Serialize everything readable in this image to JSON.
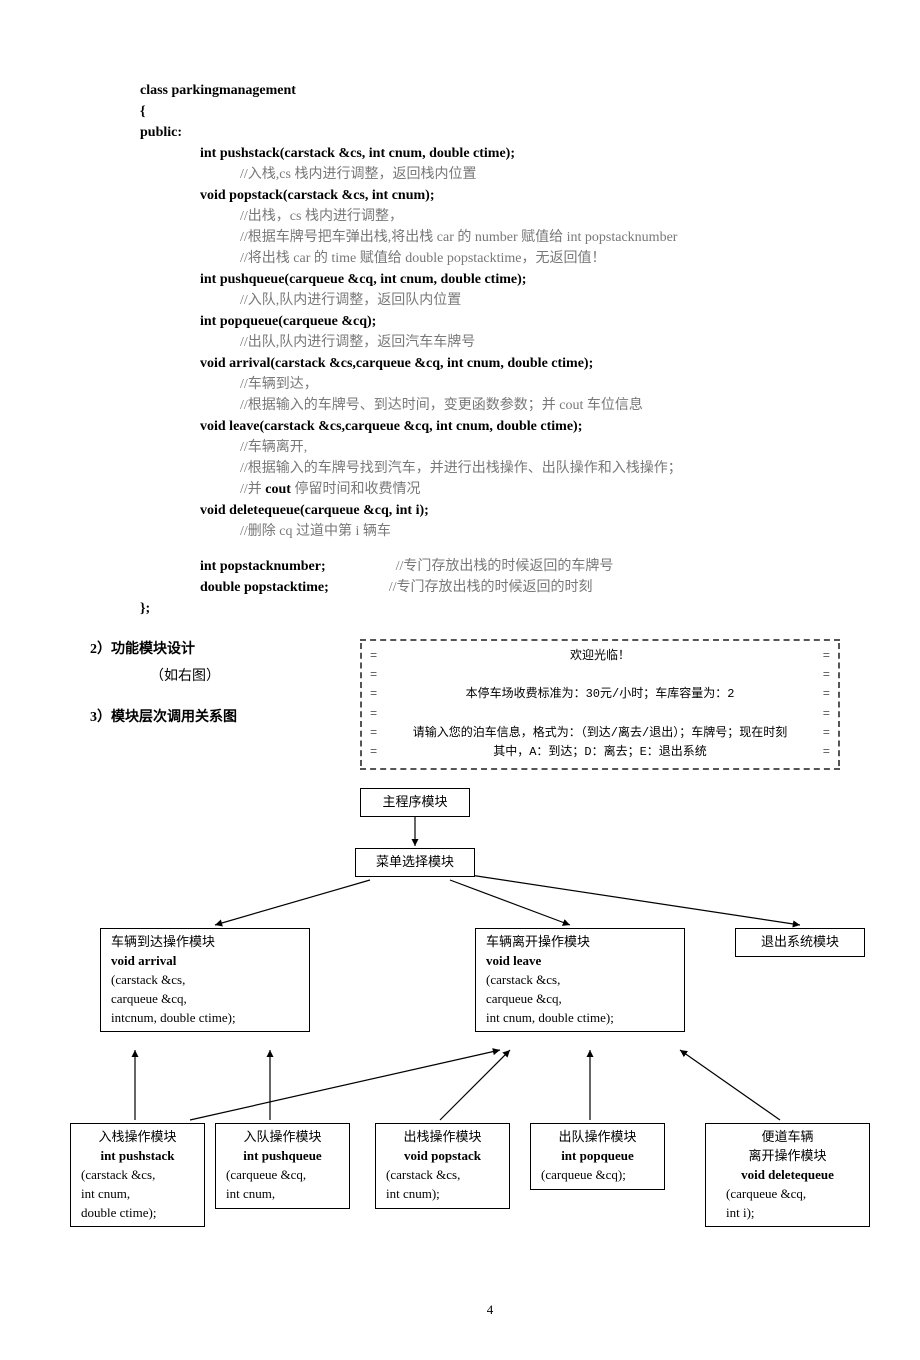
{
  "code": {
    "l1": "class parkingmanagement",
    "l2": "{",
    "l3": "public:",
    "l4": "int pushstack(carstack &cs, int cnum, double ctime);",
    "l5": "//入栈,cs 栈内进行调整，返回栈内位置",
    "l6": "void popstack(carstack &cs, int cnum);",
    "l7a": "//出栈，cs 栈内进行调整，",
    "l7b": "//根据车牌号把车弹出栈,将出栈 car 的 number 赋值给 int popstacknumber",
    "l7c": "//将出栈 car 的 time 赋值给 double popstacktime，无返回值！",
    "l8": "int pushqueue(carqueue &cq, int cnum, double ctime);",
    "l9": "//入队,队内进行调整，返回队内位置",
    "l10": "int popqueue(carqueue &cq);",
    "l11": "//出队,队内进行调整，返回汽车车牌号",
    "l12": "void arrival(carstack &cs,carqueue &cq, int cnum, double ctime);",
    "l13a": "//车辆到达，",
    "l13b": "//根据输入的车牌号、到达时间，变更函数参数；并 cout 车位信息",
    "l14": "void leave(carstack &cs,carqueue &cq, int cnum, double ctime);",
    "l15a": "//车辆离开,",
    "l15b": "//根据输入的车牌号找到汽车，并进行出栈操作、出队操作和入栈操作；",
    "l15c": "//并 cout 停留时间和收费情况",
    "l16": "void deletequeue(carqueue &cq, int i);",
    "l17": "//删除 cq 过道中第 i 辆车",
    "l18a": "int popstacknumber;",
    "l18b": "//专门存放出栈的时候返回的车牌号",
    "l19a": "double popstacktime;",
    "l19b": "//专门存放出栈的时候返回的时刻",
    "l20": "};"
  },
  "sections": {
    "s2": "2）功能模块设计",
    "s2_sub": "（如右图）",
    "s3": "3）模块层次调用关系图"
  },
  "welcome": {
    "w1": "欢迎光临！",
    "w2": "本停车场收费标准为：30元/小时；车库容量为：2",
    "w3": "请输入您的泊车信息，格式为：（到达/离去/退出）；车牌号；现在时刻",
    "w4": "其中，A：到达；D：离去；E：退出系统"
  },
  "chart_data": {
    "type": "diagram",
    "nodes": [
      {
        "id": "main",
        "label": "主程序模块"
      },
      {
        "id": "menu",
        "label": "菜单选择模块"
      },
      {
        "id": "arrival",
        "title": "车辆到达操作模块",
        "sig": "void arrival",
        "params": "(carstack &cs,\ncarqueue &cq,\nintcnum,   double ctime);"
      },
      {
        "id": "leave",
        "title": "车辆离开操作模块",
        "sig": "void leave",
        "params": "(carstack &cs,\ncarqueue &cq,\nint cnum, double ctime);"
      },
      {
        "id": "exit",
        "label": "退出系统模块"
      },
      {
        "id": "pushstack",
        "title": "入栈操作模块",
        "sig": "int pushstack",
        "params": "(carstack &cs,\n int cnum,\n double ctime);"
      },
      {
        "id": "pushqueue",
        "title": "入队操作模块",
        "sig": "int pushqueue",
        "params": "(carqueue &cq,\n int cnum,"
      },
      {
        "id": "popstack",
        "title": "出栈操作模块",
        "sig": "void popstack",
        "params": "(carstack &cs,\n int cnum);"
      },
      {
        "id": "popqueue",
        "title": "出队操作模块",
        "sig": "int popqueue",
        "params": "(carqueue &cq);"
      },
      {
        "id": "deletequeue",
        "title": "便道车辆\n离开操作模块",
        "sig": "void deletequeue",
        "params": "(carqueue &cq,\n int i);"
      }
    ],
    "edges": [
      [
        "main",
        "menu"
      ],
      [
        "menu",
        "arrival"
      ],
      [
        "menu",
        "leave"
      ],
      [
        "menu",
        "exit"
      ],
      [
        "arrival",
        "pushstack"
      ],
      [
        "arrival",
        "pushqueue"
      ],
      [
        "leave",
        "popstack"
      ],
      [
        "leave",
        "popqueue"
      ],
      [
        "leave",
        "deletequeue"
      ],
      [
        "leave",
        "pushstack"
      ]
    ]
  },
  "page": "4"
}
